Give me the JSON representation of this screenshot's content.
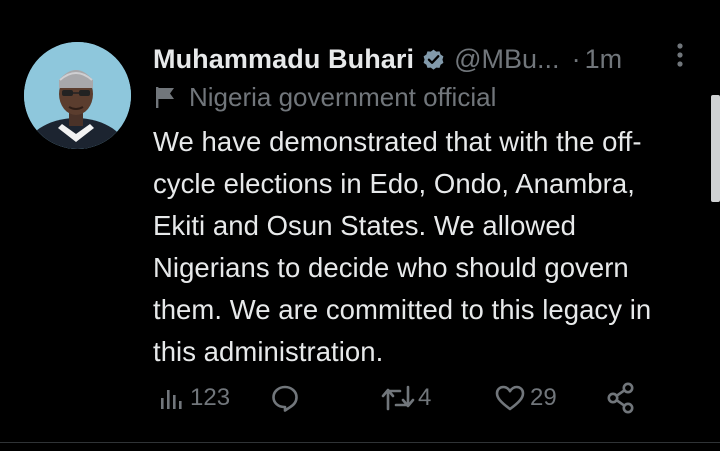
{
  "tweet": {
    "author_name": "Muhammadu Buhari",
    "author_handle": "@MBu...",
    "separator": "·",
    "timestamp": "1m",
    "account_label": "Nigeria government official",
    "text": "We have demonstrated that with the off-\ncycle elections in Edo, Ondo, Anambra,\nEkiti and Osun States. We allowed\nNigerians to decide who should govern\nthem. We are committed to this legacy in\nthis administration.",
    "views": "123",
    "retweets": "4",
    "likes": "29"
  },
  "icons": {
    "verified": "verified-badge-icon",
    "more": "more-vertical-icon",
    "label": "flag-icon",
    "views": "analytics-icon",
    "reply": "reply-icon",
    "retweet": "retweet-icon",
    "like": "heart-icon",
    "share": "share-icon"
  },
  "colors": {
    "background": "#000000",
    "text_primary": "#e7e9ea",
    "text_secondary": "#71767b",
    "verified_badge": "#829aab"
  }
}
